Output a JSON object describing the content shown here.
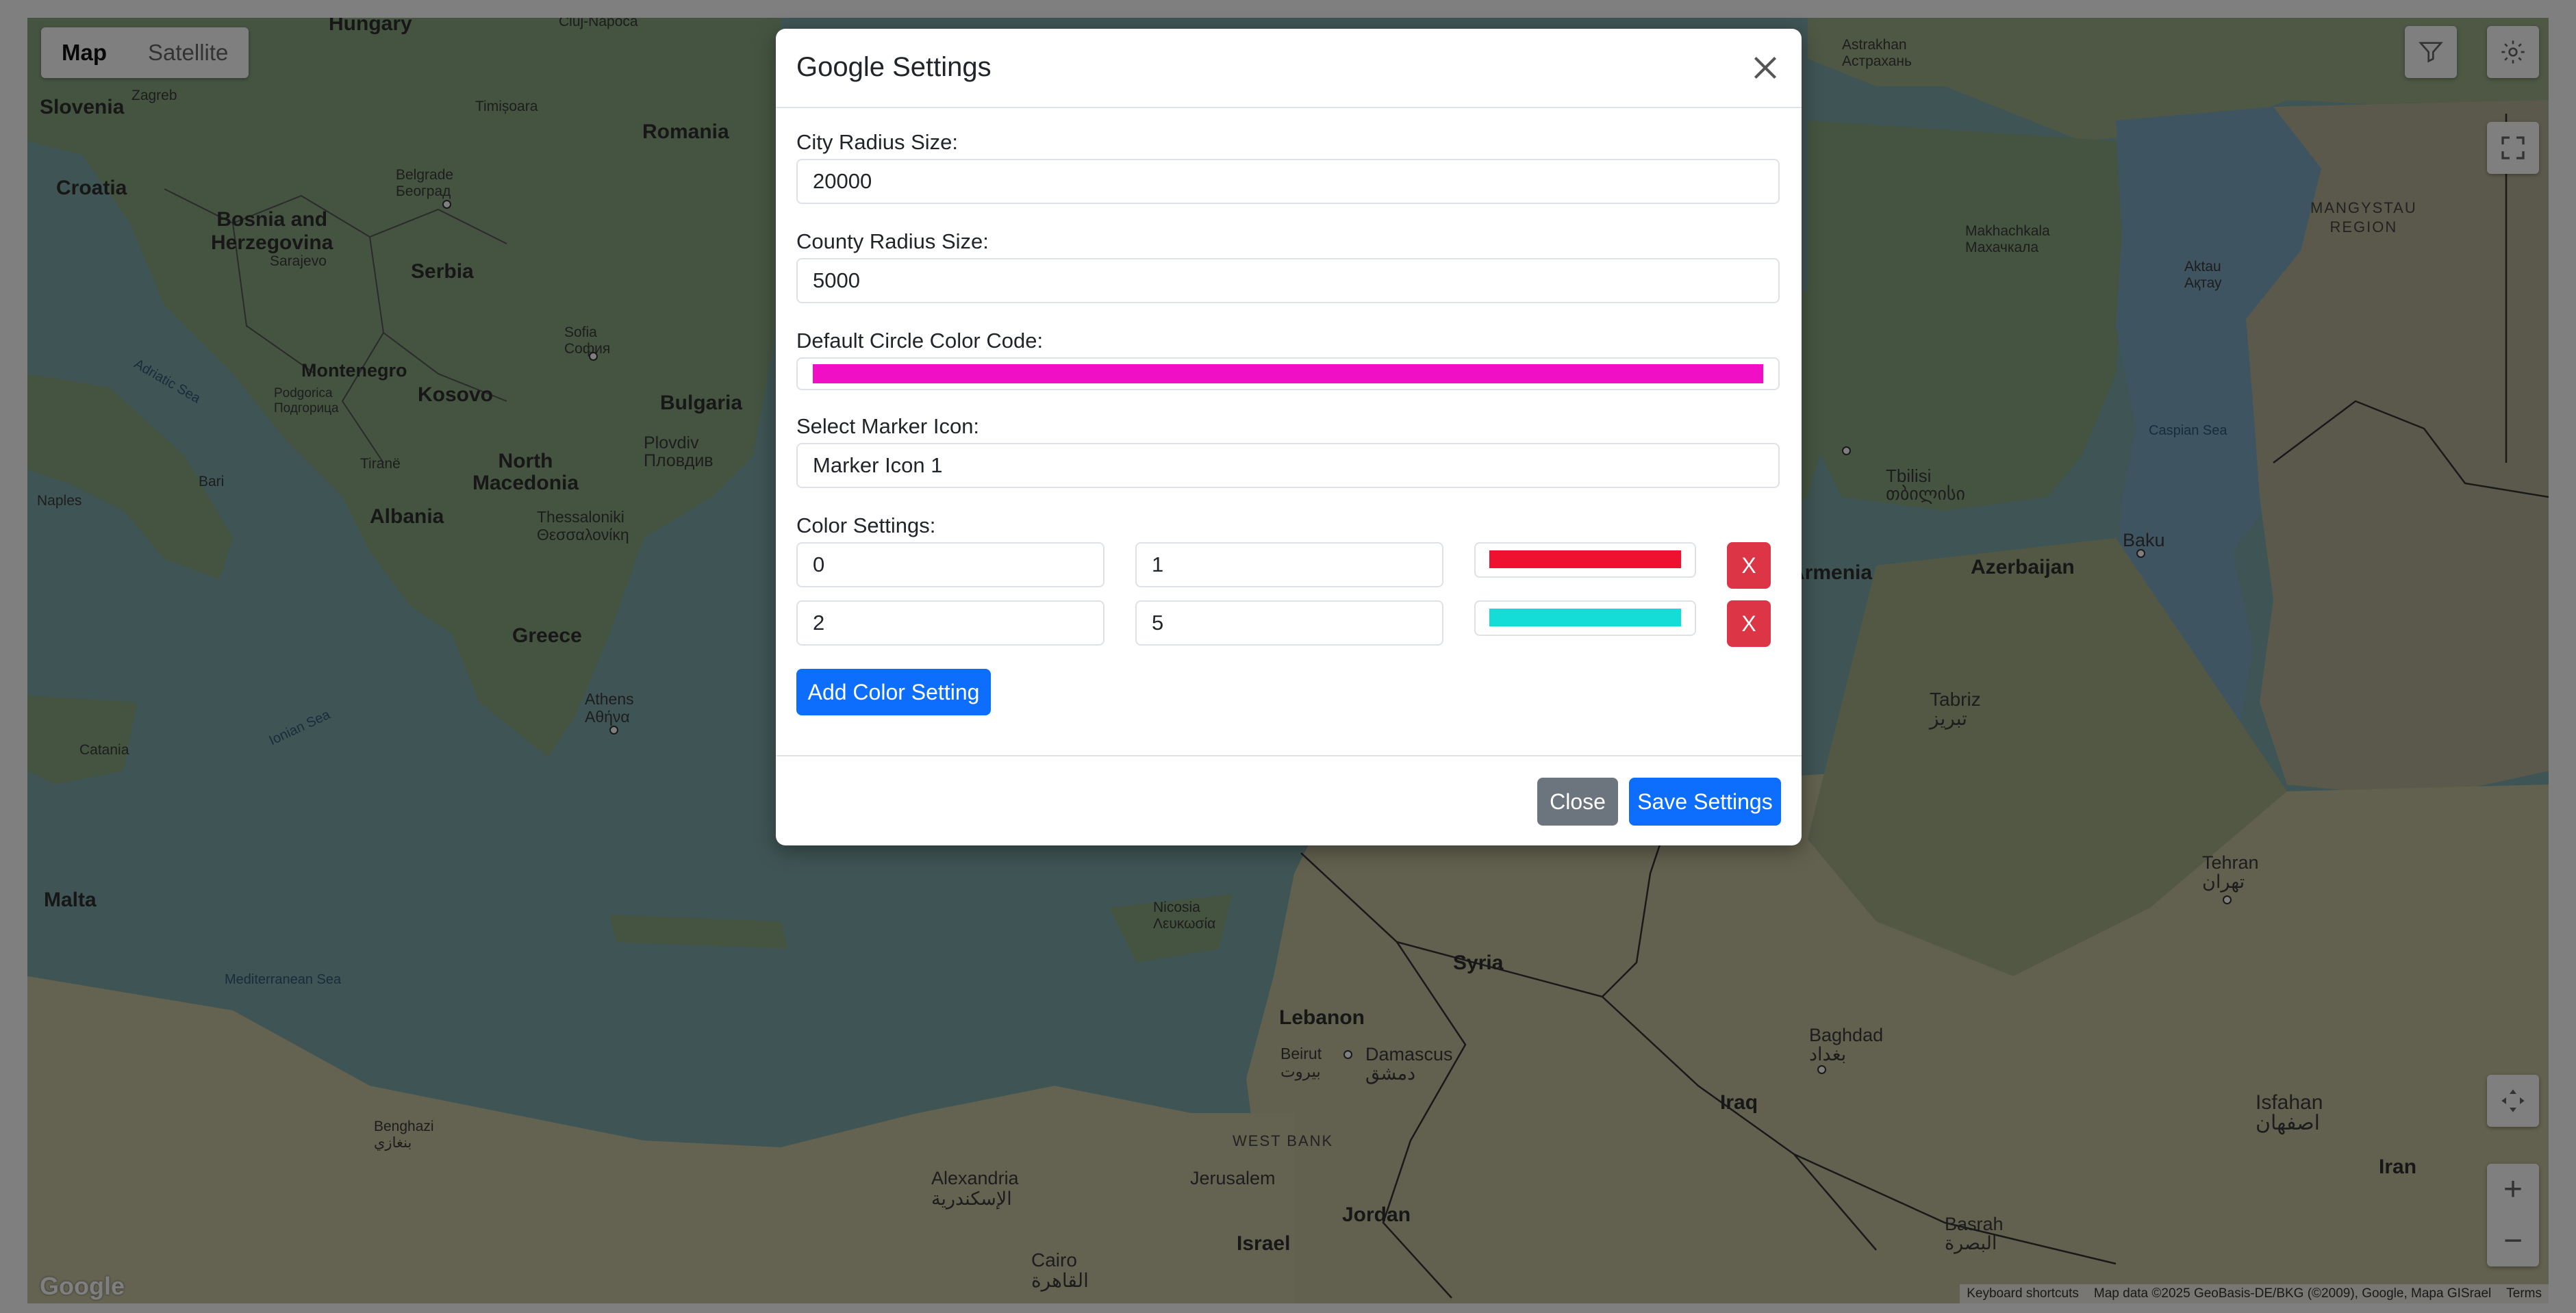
{
  "map": {
    "type_buttons": [
      "Map",
      "Satellite"
    ],
    "active_type": "Map",
    "countries": [
      {
        "id": "hungary",
        "text": "Hungary"
      },
      {
        "id": "slovenia",
        "text": "Slovenia"
      },
      {
        "id": "croatia",
        "text": "Croatia"
      },
      {
        "id": "romania",
        "text": "Romania"
      },
      {
        "id": "bosnia",
        "text": "Bosnia and\nHerzegovina"
      },
      {
        "id": "serbia",
        "text": "Serbia"
      },
      {
        "id": "montenegro",
        "text": "Montenegro"
      },
      {
        "id": "kosovo",
        "text": "Kosovo"
      },
      {
        "id": "bulgaria",
        "text": "Bulgaria"
      },
      {
        "id": "north-macedonia",
        "text": "North\nMacedonia"
      },
      {
        "id": "albania",
        "text": "Albania"
      },
      {
        "id": "greece",
        "text": "Greece"
      },
      {
        "id": "malta",
        "text": "Malta"
      },
      {
        "id": "armenia",
        "text": "Armenia"
      },
      {
        "id": "azerbaijan",
        "text": "Azerbaijan"
      },
      {
        "id": "syria",
        "text": "Syria"
      },
      {
        "id": "lebanon",
        "text": "Lebanon"
      },
      {
        "id": "iraq",
        "text": "Iraq"
      },
      {
        "id": "iran",
        "text": "Iran"
      },
      {
        "id": "jordan",
        "text": "Jordan"
      },
      {
        "id": "israel",
        "text": "Israel"
      },
      {
        "id": "mangystau",
        "text": "MANGYSTAU\nREGION"
      },
      {
        "id": "west-bank",
        "text": "WEST BANK"
      }
    ],
    "cities": [
      {
        "id": "zagreb",
        "text": "Zagreb"
      },
      {
        "id": "sarajevo",
        "text": "Sarajevo"
      },
      {
        "id": "belgrade",
        "text": "Belgrade\nБеоград"
      },
      {
        "id": "timisoara",
        "text": "Timișoara"
      },
      {
        "id": "cluj",
        "text": "Cluj-Napoca"
      },
      {
        "id": "sofia",
        "text": "Sofia\nСофия"
      },
      {
        "id": "plovdiv",
        "text": "Plovdiv\nПловдив"
      },
      {
        "id": "podgorica",
        "text": "Podgorica\nПодгорица"
      },
      {
        "id": "tirane",
        "text": "Tiranë"
      },
      {
        "id": "thessaloniki",
        "text": "Thessaloniki\nΘεσσαλονίκη"
      },
      {
        "id": "athens",
        "text": "Athens\nΑθήνα"
      },
      {
        "id": "naples",
        "text": "Naples"
      },
      {
        "id": "bari",
        "text": "Bari"
      },
      {
        "id": "catania",
        "text": "Catania"
      },
      {
        "id": "tbilisi",
        "text": "Tbilisi\nთბილისი"
      },
      {
        "id": "baku",
        "text": "Baku"
      },
      {
        "id": "tabriz",
        "text": "Tabriz\nتبریز"
      },
      {
        "id": "tehran",
        "text": "Tehran\nتهران"
      },
      {
        "id": "baghdad",
        "text": "Baghdad\nبغداد"
      },
      {
        "id": "damascus",
        "text": "Damascus\nدمشق"
      },
      {
        "id": "beirut",
        "text": "Beirut\nبيروت"
      },
      {
        "id": "nicosia",
        "text": "Nicosia\nΛευκωσία"
      },
      {
        "id": "alexandria",
        "text": "Alexandria\nالإسكندرية"
      },
      {
        "id": "cairo",
        "text": "Cairo\nالقاهرة"
      },
      {
        "id": "jerusalem",
        "text": "Jerusalem"
      },
      {
        "id": "isfahan",
        "text": "Isfahan\nاصفهان"
      },
      {
        "id": "basrah",
        "text": "Basrah\nالبصرة"
      },
      {
        "id": "aktau",
        "text": "Aktau\nАқтау"
      },
      {
        "id": "astrakhan",
        "text": "Astrakhan\nАстрахань"
      },
      {
        "id": "makhachkala",
        "text": "Makhachkala\nМахачкала"
      },
      {
        "id": "benghazi",
        "text": "Benghazi\nبنغازي"
      }
    ],
    "seas": [
      {
        "id": "caspian",
        "text": "Caspian Sea"
      },
      {
        "id": "mediterranean",
        "text": "Mediterranean Sea"
      },
      {
        "id": "ionian",
        "text": "Ionian Sea"
      },
      {
        "id": "adriatic",
        "text": "Adriatic Sea"
      }
    ],
    "google": "Google",
    "footer": [
      "Keyboard shortcuts",
      "Map data ©2025 GeoBasis-DE/BKG (©2009), Google, Mapa GISrael",
      "Terms"
    ]
  },
  "modal": {
    "title": "Google Settings",
    "city_radius": {
      "label": "City Radius Size:",
      "value": "20000"
    },
    "county_radius": {
      "label": "County Radius Size:",
      "value": "5000"
    },
    "default_color": {
      "label": "Default Circle Color Code:",
      "value": "#f00fc4"
    },
    "marker_icon": {
      "label": "Select Marker Icon:",
      "value": "Marker Icon 1"
    },
    "color_settings": {
      "label": "Color Settings:",
      "rows": [
        {
          "min": "0",
          "max": "1",
          "color": "#ee1230",
          "remove": "X"
        },
        {
          "min": "2",
          "max": "5",
          "color": "#14dcd6",
          "remove": "X"
        }
      ]
    },
    "add_button": "Add Color Setting",
    "close_button": "Close",
    "save_button": "Save Settings"
  }
}
